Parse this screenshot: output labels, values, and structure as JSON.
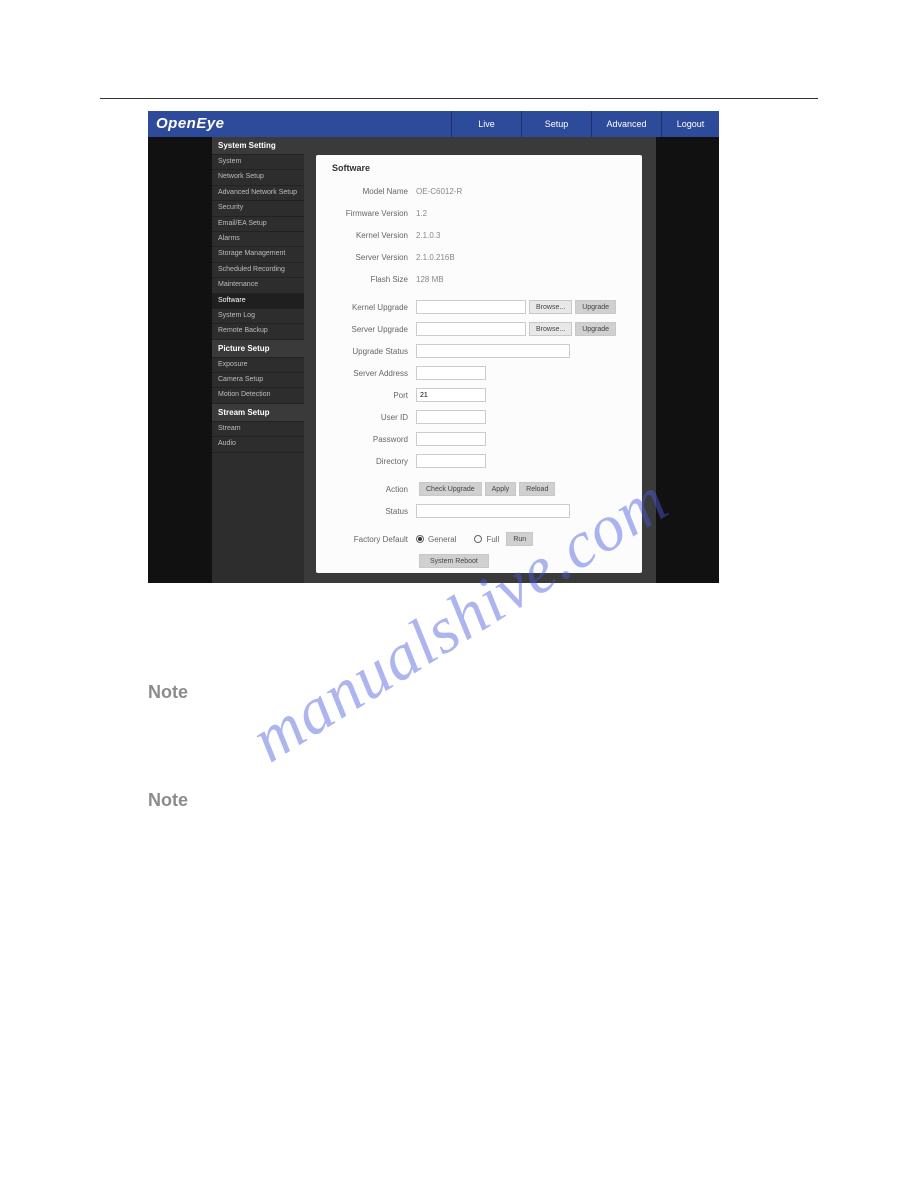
{
  "brand": "OpenEye",
  "nav": {
    "live": "Live",
    "setup": "Setup",
    "advanced": "Advanced",
    "logout": "Logout"
  },
  "sidebar": {
    "h1": "System Setting",
    "i1": "System",
    "i2": "Network Setup",
    "i3": "Advanced Network Setup",
    "i4": "Security",
    "i5": "Email/EA Setup",
    "i6": "Alarms",
    "i7": "Storage Management",
    "i8": "Scheduled Recording",
    "i9": "Maintenance",
    "i10": "Software",
    "i11": "System Log",
    "i12": "Remote Backup",
    "h2": "Picture Setup",
    "i13": "Exposure",
    "i14": "Camera Setup",
    "i15": "Motion Detection",
    "h3": "Stream Setup",
    "i16": "Stream",
    "i17": "Audio"
  },
  "panel": {
    "title": "Software",
    "model_label": "Model Name",
    "model_value": "OE-C6012-R",
    "fw_label": "Firmware Version",
    "fw_value": "1.2",
    "kernel_label": "Kernel Version",
    "kernel_value": "2.1.0.3",
    "server_label": "Server Version",
    "server_value": "2.1.0.216B",
    "flash_label": "Flash Size",
    "flash_value": "128 MB",
    "kup_label": "Kernel Upgrade",
    "sup_label": "Server Upgrade",
    "browse": "Browse...",
    "upgrade": "Upgrade",
    "ustatus_label": "Upgrade Status",
    "saddr_label": "Server Address",
    "port_label": "Port",
    "port_value": "21",
    "uid_label": "User ID",
    "pwd_label": "Password",
    "dir_label": "Directory",
    "action_label": "Action",
    "check_upgrade": "Check Upgrade",
    "apply": "Apply",
    "reload": "Reload",
    "status_label": "Status",
    "fd_label": "Factory Default",
    "fd_general": "General",
    "fd_full": "Full",
    "run": "Run",
    "reboot": "System Reboot"
  },
  "notes": {
    "label": "Note"
  },
  "watermark": "manualshive.com"
}
